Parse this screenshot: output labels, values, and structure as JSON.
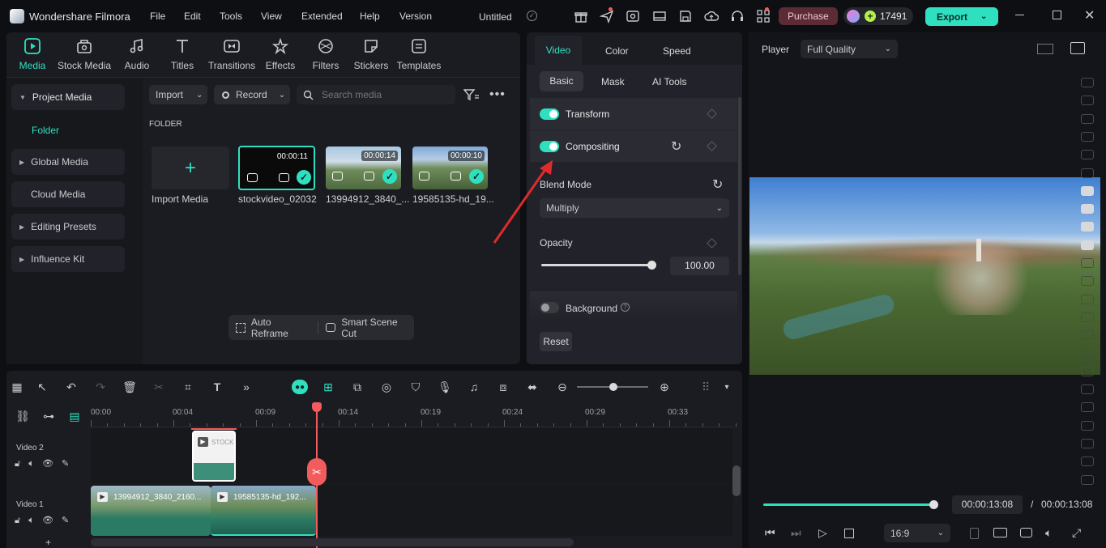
{
  "titlebar": {
    "app_name": "Wondershare Filmora",
    "menu": [
      "File",
      "Edit",
      "Tools",
      "View",
      "Extended",
      "Help",
      "Version"
    ],
    "project_title": "Untitled",
    "purchase_label": "Purchase",
    "credits": "17491",
    "export_label": "Export"
  },
  "media_toolbar": {
    "items": [
      {
        "label": "Media",
        "icon": "media-icon"
      },
      {
        "label": "Stock Media",
        "icon": "stock-media-icon"
      },
      {
        "label": "Audio",
        "icon": "music-note-icon"
      },
      {
        "label": "Titles",
        "icon": "titles-icon"
      },
      {
        "label": "Transitions",
        "icon": "transitions-icon"
      },
      {
        "label": "Effects",
        "icon": "effects-icon"
      },
      {
        "label": "Filters",
        "icon": "filters-icon"
      },
      {
        "label": "Stickers",
        "icon": "stickers-icon"
      },
      {
        "label": "Templates",
        "icon": "templates-icon"
      }
    ]
  },
  "sidebar": {
    "items": [
      {
        "label": "Project Media"
      },
      {
        "label": "Folder"
      },
      {
        "label": "Global Media"
      },
      {
        "label": "Cloud Media"
      },
      {
        "label": "Editing Presets"
      },
      {
        "label": "Influence Kit"
      }
    ]
  },
  "media_panel": {
    "import_label": "Import",
    "record_label": "Record",
    "search_placeholder": "Search media",
    "folder_heading": "FOLDER",
    "import_media_label": "Import Media",
    "clips": [
      {
        "name": "stockvideo_02032",
        "duration": "00:00:11"
      },
      {
        "name": "13994912_3840_...",
        "duration": "00:00:14"
      },
      {
        "name": "19585135-hd_19...",
        "duration": "00:00:10"
      }
    ],
    "auto_reframe": "Auto Reframe",
    "smart_scene_cut": "Smart Scene Cut"
  },
  "properties": {
    "tabs": [
      "Video",
      "Color",
      "Speed"
    ],
    "subtabs": [
      "Basic",
      "Mask",
      "AI Tools"
    ],
    "transform_label": "Transform",
    "compositing_label": "Compositing",
    "blend_mode_label": "Blend Mode",
    "blend_mode_value": "Multiply",
    "opacity_label": "Opacity",
    "opacity_value": "100.00",
    "opacity_fraction": 1.0,
    "background_label": "Background",
    "reset_label": "Reset"
  },
  "player": {
    "label": "Player",
    "quality": "Full Quality",
    "current_time": "00:00:13:08",
    "separator": "/",
    "total_time": "00:00:13:08",
    "aspect_ratio": "16:9",
    "progress_fraction": 1.0
  },
  "timeline": {
    "ruler": [
      "00:00",
      "00:04",
      "00:09",
      "00:14",
      "00:19",
      "00:24",
      "00:29",
      "00:33"
    ],
    "tracks": [
      {
        "name": "Video 2",
        "clips": [
          {
            "label": "STOCK"
          }
        ]
      },
      {
        "name": "Video 1",
        "clips": [
          {
            "label": "13994912_3840_2160..."
          },
          {
            "label": "19585135-hd_192..."
          }
        ]
      }
    ]
  },
  "colors": {
    "accent": "#2fe0c0",
    "playhead": "#f25c5c",
    "purchase_bg": "#5c2b35",
    "panel": "#1b1c21"
  }
}
